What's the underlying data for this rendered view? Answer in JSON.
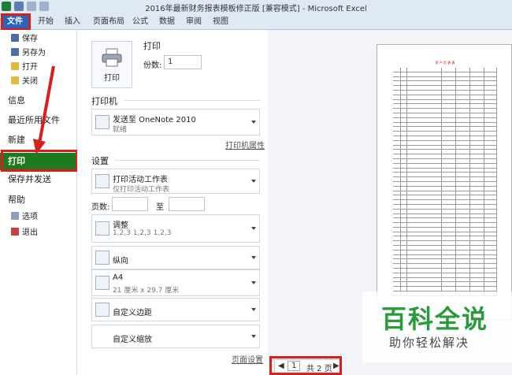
{
  "window": {
    "title": "2016年最新财务报表模板修正版  [兼容模式] - Microsoft Excel"
  },
  "ribbon": {
    "tabs": [
      "文件",
      "开始",
      "插入",
      "页面布局",
      "公式",
      "数据",
      "审阅",
      "视图"
    ]
  },
  "nav": {
    "items": [
      {
        "label": "保存"
      },
      {
        "label": "另存为"
      },
      {
        "label": "打开"
      },
      {
        "label": "关闭"
      },
      {
        "label": "信息"
      },
      {
        "label": "最近所用文件"
      },
      {
        "label": "新建"
      },
      {
        "label": "打印"
      },
      {
        "label": "保存并发送"
      },
      {
        "label": "帮助"
      },
      {
        "label": "选项"
      },
      {
        "label": "退出"
      }
    ]
  },
  "print": {
    "heading": "打印",
    "button_label": "打印",
    "copies_label": "份数:",
    "copies_value": "1",
    "printer_section": "打印机",
    "printer_name": "发送至 OneNote 2010",
    "printer_status": "就绪",
    "printer_props_link": "打印机属性",
    "settings_section": "设置",
    "what": {
      "title": "打印活动工作表",
      "sub": "仅打印活动工作表"
    },
    "pages_label": "页数:",
    "to_label": "至",
    "collate": {
      "title": "调整",
      "sub": "1,2,3    1,2,3    1,2,3"
    },
    "orientation": "纵向",
    "paper": {
      "title": "A4",
      "sub": "21 厘米 x 29.7 厘米"
    },
    "margins": "自定义边距",
    "scaling": "自定义缩放",
    "page_setup_link": "页面设置"
  },
  "preview": {
    "pager_current": "1",
    "pager_total": "共 2 页",
    "sheet_title": "资 产 负 债 表"
  },
  "watermark": {
    "title": "百科全说",
    "subtitle": "助你轻松解决"
  },
  "colors": {
    "file_tab": "#2a63b9",
    "print_active": "#1f7a1f",
    "highlight": "#d81e1e",
    "watermark": "#2a9a3c"
  }
}
